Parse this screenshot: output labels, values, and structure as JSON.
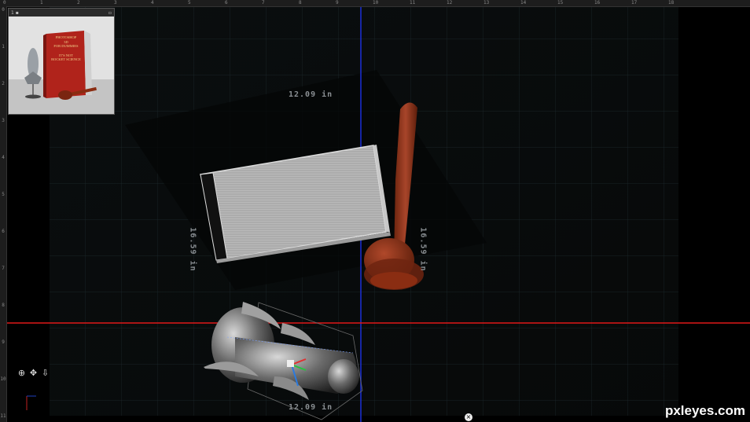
{
  "rulers": {
    "top_ticks": [
      "0",
      "1",
      "2",
      "3",
      "4",
      "5",
      "6",
      "7",
      "8",
      "9",
      "10",
      "11",
      "12",
      "13",
      "14",
      "15",
      "16",
      "17",
      "18"
    ],
    "left_ticks": [
      "0",
      "1",
      "2",
      "3",
      "4",
      "5",
      "6",
      "7",
      "8",
      "9",
      "10",
      "11"
    ]
  },
  "dimensions": {
    "top_width": "12.09 in",
    "bottom_width": "12.09 in",
    "left_height": "16.59 in",
    "right_height": "16.59 in"
  },
  "thumbnail": {
    "toolbar_left": "1 ▪",
    "toolbar_right": "▫",
    "book_title_line1": "PHOTOSHOP",
    "book_title_line2": "3D",
    "book_title_line3": "FOR DUMMIES",
    "book_subtitle_line1": "IT'S NOT",
    "book_subtitle_line2": "ROCKET SCIENCE"
  },
  "nav_tools": {
    "orbit_icon": "⊕",
    "pan_icon": "✥",
    "walk_icon": "⇩"
  },
  "close_label": "×",
  "watermark": "pxleyes.com",
  "colors": {
    "horizon_axis": "#e01818",
    "vertical_axis": "#1a2fd8",
    "grid": "#1e2a2e",
    "gavel": "#8a2d12"
  }
}
